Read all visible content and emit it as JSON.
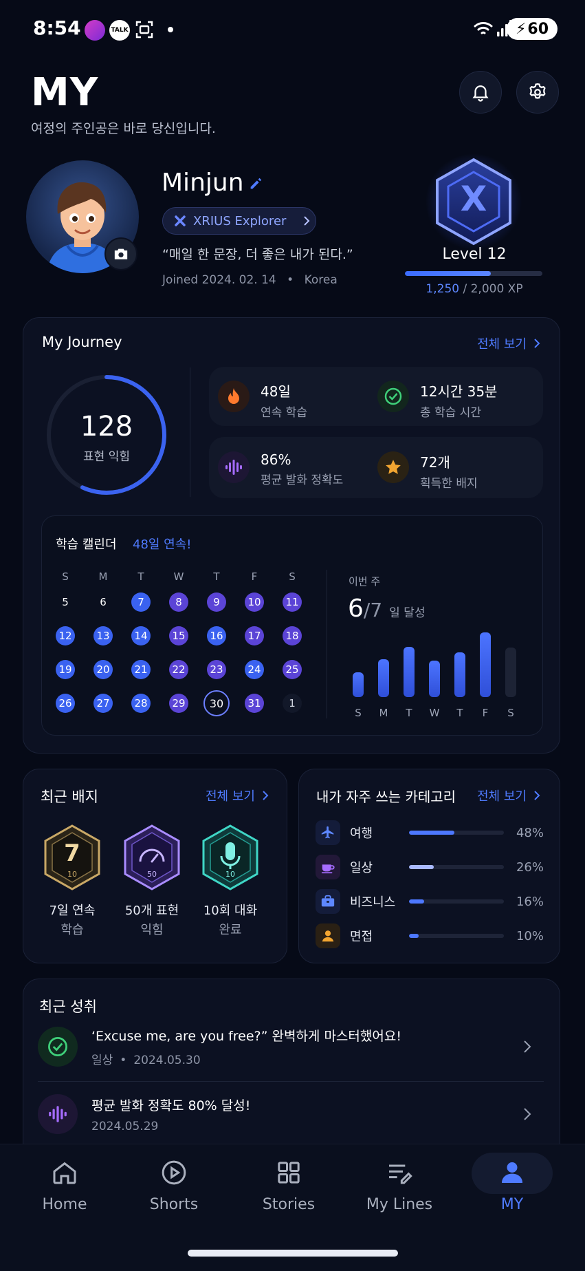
{
  "status": {
    "time": "8:54",
    "battery": "60",
    "talk": "TALK"
  },
  "header": {
    "title": "MY",
    "subtitle": "여정의 주인공은 바로 당신입니다."
  },
  "profile": {
    "name": "Minjun",
    "badge_title": "XRIUS Explorer",
    "motto": "“매일 한 문장, 더 좋은 내가 된다.”",
    "joined": "Joined 2024. 02. 14",
    "country": "Korea",
    "level_label": "Level 12",
    "xp_current": "1,250",
    "xp_total": "/ 2,000 XP",
    "xp_fraction": 0.625,
    "emblem_letter": "X"
  },
  "journey": {
    "title": "My Journey",
    "see_all": "전체 보기",
    "ring_value": "128",
    "ring_label": "표현 익힘",
    "stats": [
      {
        "value": "48일",
        "label": "연속 학습",
        "icon": "fire-icon"
      },
      {
        "value": "12시간 35분",
        "label": "총 학습 시간",
        "icon": "check-circle-icon"
      },
      {
        "value": "86%",
        "label": "평균 발화 정확도",
        "icon": "soundwave-icon"
      },
      {
        "value": "72개",
        "label": "획득한 배지",
        "icon": "star-icon"
      }
    ]
  },
  "calendar": {
    "title": "학습 캘린더",
    "streak": "48일 연속!",
    "weekdays": [
      "S",
      "M",
      "T",
      "W",
      "T",
      "F",
      "S"
    ],
    "weeks": [
      [
        {
          "d": "5",
          "s": "plain"
        },
        {
          "d": "6",
          "s": "plain"
        },
        {
          "d": "7",
          "s": "blue"
        },
        {
          "d": "8",
          "s": "purple"
        },
        {
          "d": "9",
          "s": "purple"
        },
        {
          "d": "10",
          "s": "purple"
        },
        {
          "d": "11",
          "s": "purple"
        }
      ],
      [
        {
          "d": "12",
          "s": "blue"
        },
        {
          "d": "13",
          "s": "blue"
        },
        {
          "d": "14",
          "s": "blue"
        },
        {
          "d": "15",
          "s": "purple"
        },
        {
          "d": "16",
          "s": "blue"
        },
        {
          "d": "17",
          "s": "purple"
        },
        {
          "d": "18",
          "s": "purple"
        }
      ],
      [
        {
          "d": "19",
          "s": "blue"
        },
        {
          "d": "20",
          "s": "blue"
        },
        {
          "d": "21",
          "s": "blue"
        },
        {
          "d": "22",
          "s": "purple"
        },
        {
          "d": "23",
          "s": "purple"
        },
        {
          "d": "24",
          "s": "blue"
        },
        {
          "d": "25",
          "s": "purple"
        }
      ],
      [
        {
          "d": "26",
          "s": "blue"
        },
        {
          "d": "27",
          "s": "blue"
        },
        {
          "d": "28",
          "s": "blue"
        },
        {
          "d": "29",
          "s": "purple"
        },
        {
          "d": "30",
          "s": "today"
        },
        {
          "d": "31",
          "s": "purple"
        },
        {
          "d": "1",
          "s": "dim"
        }
      ]
    ],
    "week_label": "이번 주",
    "week_done": "6",
    "week_total": "/7",
    "week_suffix": "일 달성"
  },
  "chart_data": {
    "type": "bar",
    "categories": [
      "S",
      "M",
      "T",
      "W",
      "T",
      "F",
      "S"
    ],
    "values": [
      3,
      4.6,
      6.1,
      4.4,
      5.4,
      7.8,
      0
    ],
    "ylim": [
      0,
      8
    ]
  },
  "badges": {
    "title": "최근 배지",
    "see_all": "전체 보기",
    "items": [
      {
        "num": "7",
        "small": "10",
        "line1": "7일 연속",
        "line2": "학습",
        "icon": "number-badge-icon"
      },
      {
        "num": "",
        "small": "50",
        "line1": "50개 표현",
        "line2": "익힘",
        "icon": "speedometer-badge-icon"
      },
      {
        "num": "",
        "small": "10",
        "line1": "10회 대화",
        "line2": "완료",
        "icon": "microphone-badge-icon"
      }
    ]
  },
  "categories": {
    "title": "내가 자주 쓰는 카테고리",
    "see_all": "전체 보기",
    "items": [
      {
        "name": "여행",
        "pct": "48%",
        "value": 0.48,
        "color": "#4d78ff",
        "icon": "airplane-icon"
      },
      {
        "name": "일상",
        "pct": "26%",
        "value": 0.26,
        "color": "#a9b9ff",
        "icon": "coffee-icon"
      },
      {
        "name": "비즈니스",
        "pct": "16%",
        "value": 0.16,
        "color": "#4d78ff",
        "icon": "briefcase-icon"
      },
      {
        "name": "면접",
        "pct": "10%",
        "value": 0.1,
        "color": "#4d78ff",
        "icon": "person-icon"
      }
    ]
  },
  "achievements": {
    "title": "최근 성취",
    "items": [
      {
        "title": "‘Excuse me, are you free?”  완벽하게 마스터했어요!",
        "category": "일상",
        "date": "2024.05.30"
      },
      {
        "title": "평균 발화 정확도 80% 달성!",
        "date": "2024.05.29"
      }
    ]
  },
  "nav": [
    {
      "label": "Home"
    },
    {
      "label": "Shorts"
    },
    {
      "label": "Stories"
    },
    {
      "label": "My Lines"
    },
    {
      "label": "MY"
    }
  ],
  "colors": {
    "accent": "#4f7bff",
    "purple": "#5b44d6",
    "background": "#060a17"
  }
}
